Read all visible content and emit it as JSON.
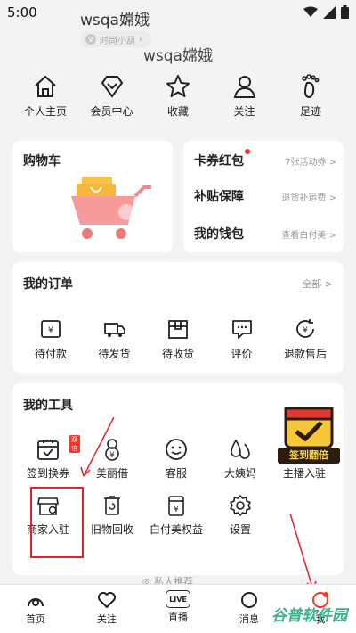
{
  "status_bar": {
    "time": "5:00"
  },
  "profile": {
    "username": "wsqa嫦娥",
    "badge": "时尚小葫",
    "display_name": "wsqa嫦娥"
  },
  "quick_links": [
    {
      "label": "个人主页",
      "icon": "home-icon"
    },
    {
      "label": "会员中心",
      "icon": "diamond-icon"
    },
    {
      "label": "收藏",
      "icon": "star-icon"
    },
    {
      "label": "关注",
      "icon": "person-icon"
    },
    {
      "label": "足迹",
      "icon": "footprint-icon"
    }
  ],
  "cart": {
    "title": "购物车"
  },
  "rights": [
    {
      "label": "卡券红包",
      "detail": "7张活动券 >"
    },
    {
      "label": "补贴保障",
      "detail": "退货补运费 >"
    },
    {
      "label": "我的钱包",
      "detail": "查看白付美 >"
    }
  ],
  "orders": {
    "title": "我的订单",
    "all": "全部 >",
    "items": [
      {
        "label": "待付款",
        "icon": "wallet-icon"
      },
      {
        "label": "待发货",
        "icon": "truck-icon"
      },
      {
        "label": "待收货",
        "icon": "box-icon"
      },
      {
        "label": "评价",
        "icon": "comment-icon"
      },
      {
        "label": "退款售后",
        "icon": "refund-icon"
      }
    ]
  },
  "tools": {
    "title": "我的工具",
    "badge": "双倍",
    "items": [
      {
        "label": "签到换券",
        "icon": "calendar-check-icon"
      },
      {
        "label": "美丽借",
        "icon": "flower-yen-icon"
      },
      {
        "label": "客服",
        "icon": "smile-icon"
      },
      {
        "label": "大姨妈",
        "icon": "drops-icon"
      },
      {
        "label": "主播入驻",
        "icon": "anchor-icon"
      },
      {
        "label": "商家入驻",
        "icon": "shop-icon"
      },
      {
        "label": "旧物回收",
        "icon": "recycle-icon"
      },
      {
        "label": "白付美权益",
        "icon": "yen-card-icon"
      },
      {
        "label": "设置",
        "icon": "gear-icon"
      }
    ],
    "more": "◎ 私人推荐"
  },
  "signin_promo": "签到翻倍",
  "bottom_nav": [
    {
      "label": "首页",
      "icon": "home-nav-icon"
    },
    {
      "label": "关注",
      "icon": "heart-icon"
    },
    {
      "label": "直播",
      "icon": "live-icon",
      "icon_text": "LIVE"
    },
    {
      "label": "消息",
      "icon": "message-icon"
    },
    {
      "label": "我",
      "icon": "me-icon"
    }
  ],
  "watermark": "谷普软件园",
  "colors": {
    "accent": "#f2372c",
    "highlight_box": "#e4222b"
  }
}
